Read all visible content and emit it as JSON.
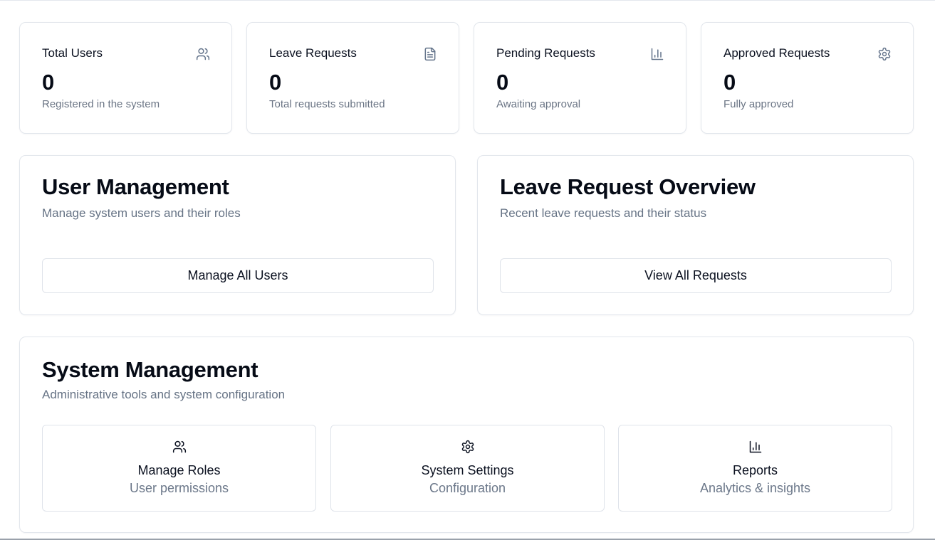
{
  "stats": [
    {
      "title": "Total Users",
      "value": "0",
      "description": "Registered in the system",
      "icon": "users-icon"
    },
    {
      "title": "Leave Requests",
      "value": "0",
      "description": "Total requests submitted",
      "icon": "file-text-icon"
    },
    {
      "title": "Pending Requests",
      "value": "0",
      "description": "Awaiting approval",
      "icon": "bar-chart-icon"
    },
    {
      "title": "Approved Requests",
      "value": "0",
      "description": "Fully approved",
      "icon": "gear-icon"
    }
  ],
  "user_management": {
    "title": "User Management",
    "subtitle": "Manage system users and their roles",
    "button_label": "Manage All Users"
  },
  "leave_overview": {
    "title": "Leave Request Overview",
    "subtitle": "Recent leave requests and their status",
    "button_label": "View All Requests"
  },
  "system_management": {
    "title": "System Management",
    "subtitle": "Administrative tools and system configuration",
    "tiles": [
      {
        "title": "Manage Roles",
        "subtitle": "User permissions",
        "icon": "users-icon"
      },
      {
        "title": "System Settings",
        "subtitle": "Configuration",
        "icon": "gear-icon"
      },
      {
        "title": "Reports",
        "subtitle": "Analytics & insights",
        "icon": "bar-chart-icon"
      }
    ]
  },
  "colors": {
    "text_primary": "#0b1120",
    "text_muted": "#6b7585",
    "border": "#e2e6ec"
  }
}
